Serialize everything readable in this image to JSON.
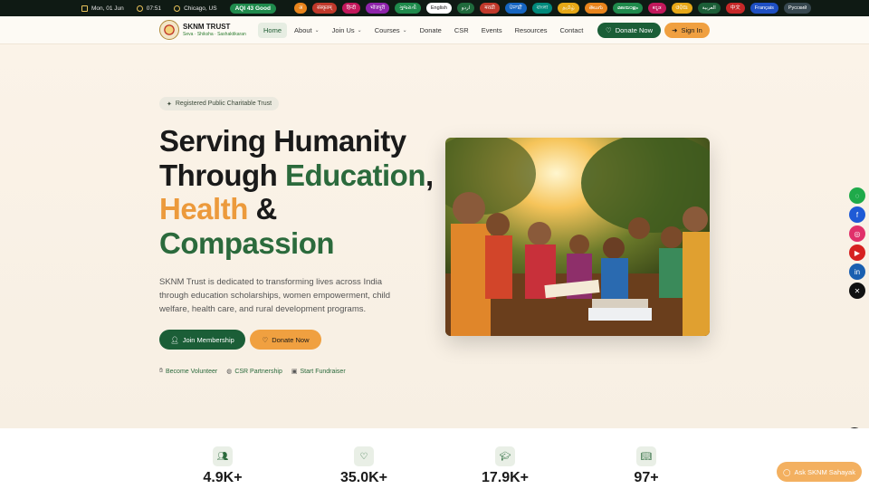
{
  "topbar": {
    "date": "Mon, 01 Jun",
    "time": "07:51",
    "location": "Chicago, US",
    "aqi": "AQI 43 Good",
    "languages": [
      {
        "label": "अ",
        "color": "#e8841c"
      },
      {
        "label": "संस्कृतम्",
        "color": "#c0392b"
      },
      {
        "label": "हिन्दी",
        "color": "#c2185b"
      },
      {
        "label": "भोजपुरी",
        "color": "#8e24aa"
      },
      {
        "label": "ગુજરાતી",
        "color": "#1f8a4c"
      },
      {
        "label": "English",
        "color": "#ffffff"
      },
      {
        "label": "اردو",
        "color": "#1f6a3c"
      },
      {
        "label": "मराठी",
        "color": "#c0392b"
      },
      {
        "label": "ਪੰਜਾਬੀ",
        "color": "#1565c0"
      },
      {
        "label": "বাংলা",
        "color": "#00897b"
      },
      {
        "label": "தமிழ்",
        "color": "#e6a817"
      },
      {
        "label": "తెలుగు",
        "color": "#e8841c"
      },
      {
        "label": "മലയാളം",
        "color": "#1f8a4c"
      },
      {
        "label": "ಕನ್ನಡ",
        "color": "#c2185b"
      },
      {
        "label": "ଓଡ଼ିଆ",
        "color": "#e6a817"
      },
      {
        "label": "العربية",
        "color": "#1b5e37"
      },
      {
        "label": "中文",
        "color": "#c62828"
      },
      {
        "label": "Français",
        "color": "#1e4fc2"
      },
      {
        "label": "Русский",
        "color": "#37474f"
      }
    ]
  },
  "nav": {
    "logo_title": "SKNM TRUST",
    "logo_sub": "Seva · Shiksha · Sashaktikaran",
    "items": [
      {
        "label": "Home",
        "active": true,
        "dropdown": false
      },
      {
        "label": "About",
        "active": false,
        "dropdown": true
      },
      {
        "label": "Join Us",
        "active": false,
        "dropdown": true
      },
      {
        "label": "Courses",
        "active": false,
        "dropdown": true
      },
      {
        "label": "Donate",
        "active": false,
        "dropdown": false
      },
      {
        "label": "CSR",
        "active": false,
        "dropdown": false
      },
      {
        "label": "Events",
        "active": false,
        "dropdown": false
      },
      {
        "label": "Resources",
        "active": false,
        "dropdown": false
      },
      {
        "label": "Contact",
        "active": false,
        "dropdown": false
      }
    ],
    "donate_label": "Donate Now",
    "signin_label": "Sign In"
  },
  "hero": {
    "badge": "Registered Public Charitable Trust",
    "headline": {
      "l1": "Serving Humanity",
      "l2a": "Through ",
      "l2b": "Education",
      "l2c": ",",
      "l3a": "Health",
      "l3b": " &",
      "l4": "Compassion"
    },
    "description": "SKNM Trust is dedicated to transforming lives across India through education scholarships, women empowerment, child welfare, health care, and rural development programs.",
    "join_label": "Join Membership",
    "donate_label": "Donate Now",
    "links": [
      "Become Volunteer",
      "CSR Partnership",
      "Start Fundraiser"
    ]
  },
  "stats": [
    "4.9K+",
    "35.0K+",
    "17.9K+",
    "97+"
  ],
  "assistant_label": "Ask SKNM Sahayak",
  "colors": {
    "primary": "#1b5e37",
    "accent": "#f0a040",
    "background": "#fbf5ec"
  }
}
